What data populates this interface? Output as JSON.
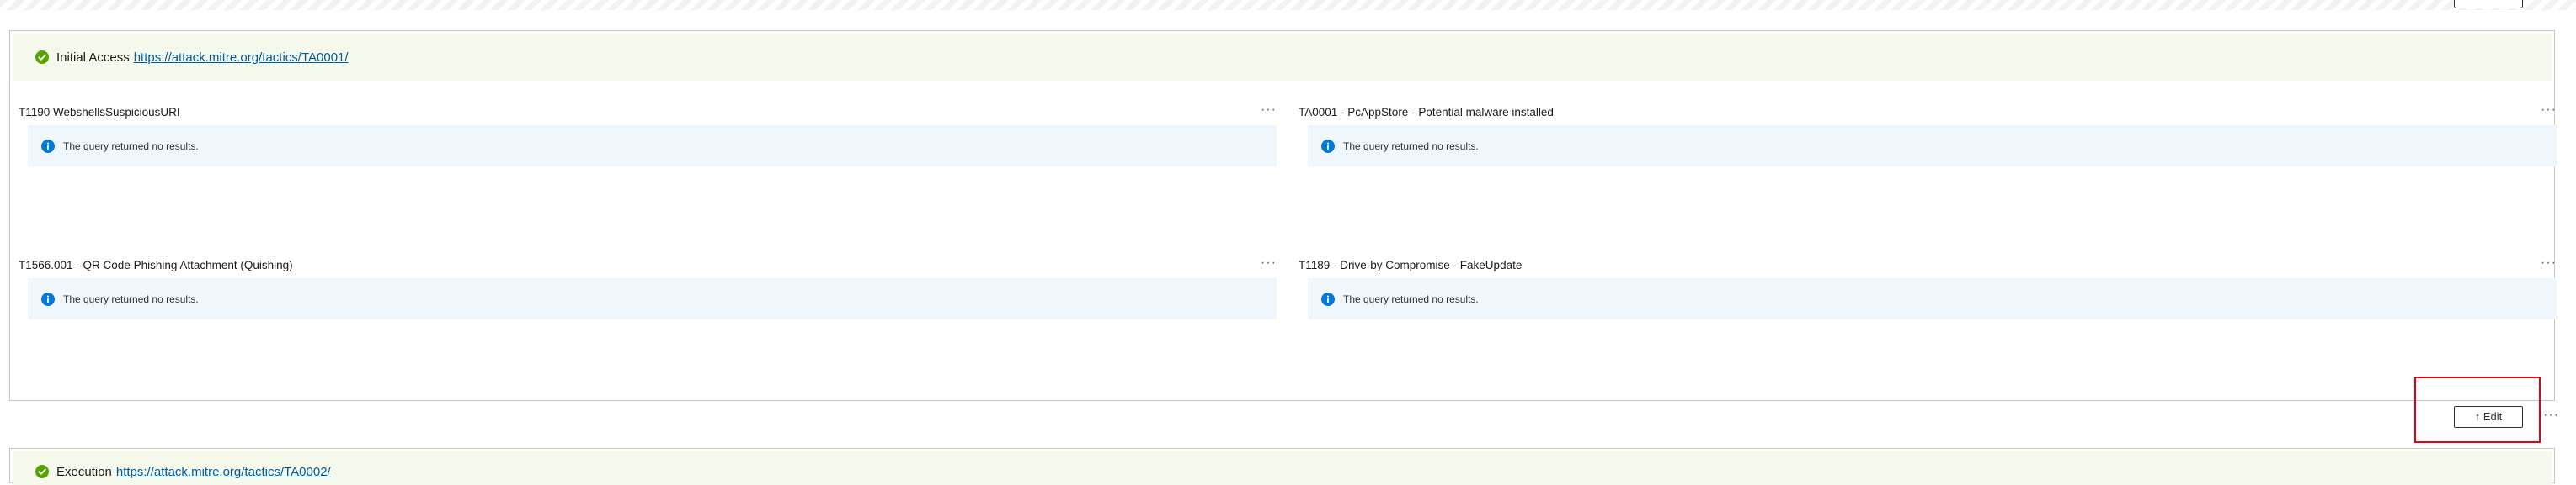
{
  "toolbar": {
    "edit_label": "↑ Edit",
    "more_label": "···"
  },
  "group": {
    "title": "Initial Access",
    "link": "https://attack.mitre.org/tactics/TA0001/",
    "status_color": "#57a300",
    "header_bg": "#f4f9ec"
  },
  "tiles": [
    {
      "title": "T1190 WebshellsSuspiciousURI",
      "message": "The query returned no results."
    },
    {
      "title": "TA0001 - PcAppStore - Potential malware installed",
      "message": "The query returned no results."
    },
    {
      "title": "T1566.001 - QR Code Phishing Attachment (Quishing)",
      "message": "The query returned no results."
    },
    {
      "title": "T1189 - Drive-by Compromise - FakeUpdate",
      "message": "The query returned no results."
    }
  ],
  "next_group": {
    "title": "Execution",
    "link": "https://attack.mitre.org/tactics/TA0002/"
  },
  "icons": {
    "success": "check-circle-icon",
    "info": "info-icon",
    "more": "more-icon"
  },
  "colors": {
    "info": "#0078d4",
    "highlight_border": "#e3000f",
    "link": "#005a9e"
  }
}
